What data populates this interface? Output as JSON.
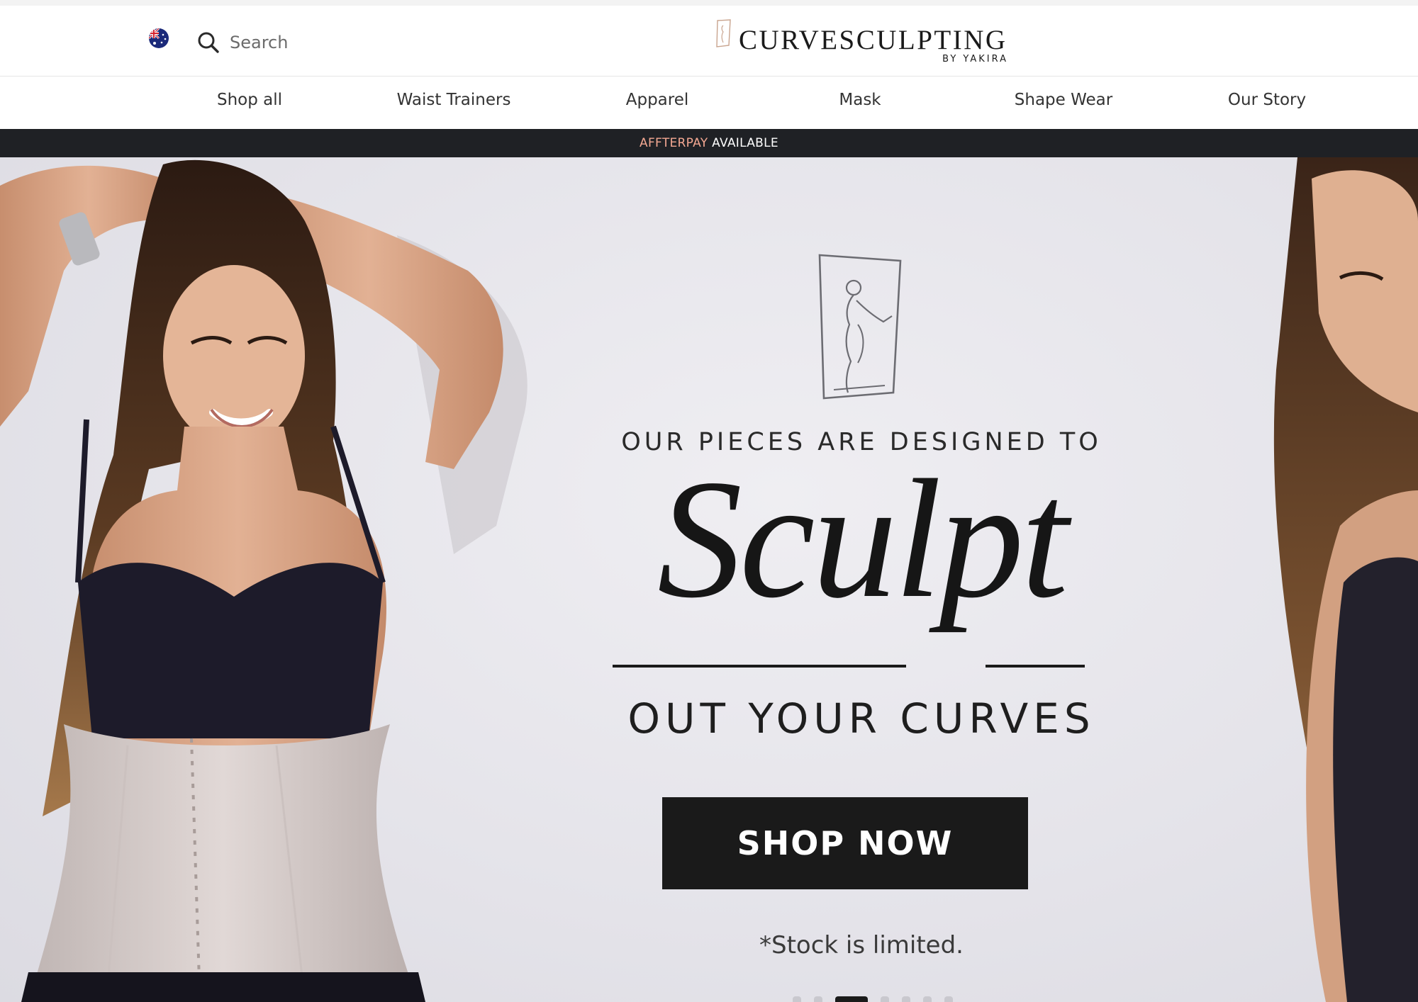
{
  "header": {
    "search": {
      "placeholder": "Search"
    },
    "logo": {
      "wordmark": "CURVESCULPTING",
      "byline": "BY YAKIRA"
    }
  },
  "nav": {
    "items": [
      {
        "label": "Shop all"
      },
      {
        "label": "Waist Trainers"
      },
      {
        "label": "Apparel"
      },
      {
        "label": "Mask"
      },
      {
        "label": "Shape Wear"
      },
      {
        "label": "Our Story"
      }
    ]
  },
  "announcement": {
    "brand": "AFFTERPAY",
    "text": "AVAILABLE",
    "brand_color": "#f4a892",
    "background": "#1f2125"
  },
  "hero": {
    "kicker": "OUR PIECES ARE DESIGNED TO",
    "script_word": "Sculpt",
    "line2": "OUT YOUR CURVES",
    "cta_label": "SHOP NOW",
    "note": "*Stock is limited.",
    "slides": {
      "count": 7,
      "active_index": 2
    }
  },
  "icons": {
    "region": "australia-flag-icon",
    "search": "search-icon",
    "emblem": "mirror-silhouette-icon"
  }
}
